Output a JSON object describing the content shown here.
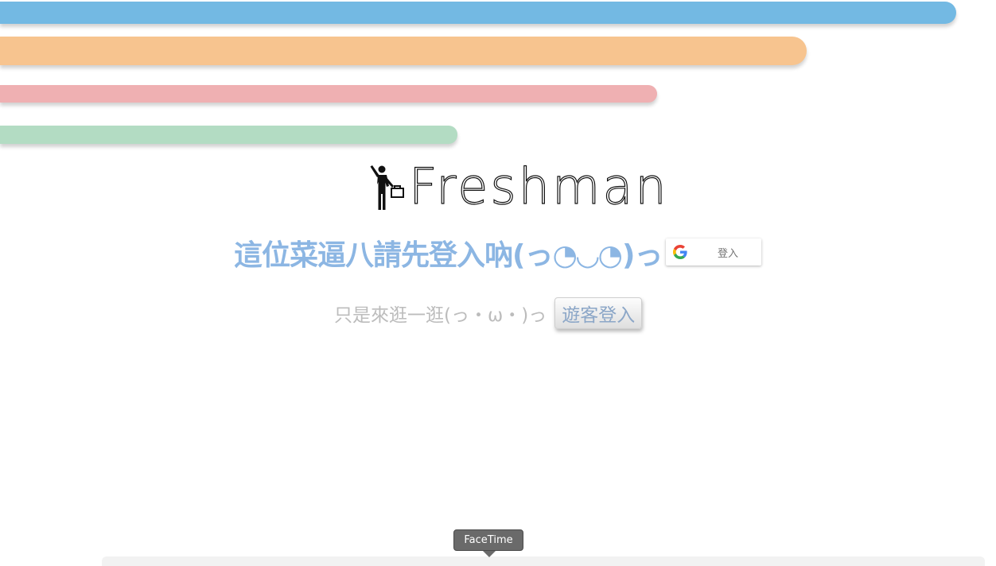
{
  "colors": {
    "bar_blue": "#73b9e3",
    "bar_orange": "#f7c48f",
    "bar_pink": "#efb0b2",
    "bar_green": "#b3dcc3",
    "prompt_blue": "#8cb6e3",
    "guest_text": "#bcbcbc"
  },
  "logo": {
    "icon": "person-with-briefcase-icon",
    "text": "Freshman"
  },
  "login": {
    "prompt": "這位菜逼八請先登入吶(っ◔◡◔)っ",
    "google_icon": "google-g-icon",
    "google_label": "登入"
  },
  "guest": {
    "prompt": "只是來逛一逛(っ・ω・)っ",
    "button_label": "遊客登入"
  },
  "dock": {
    "tooltip": "FaceTime"
  }
}
